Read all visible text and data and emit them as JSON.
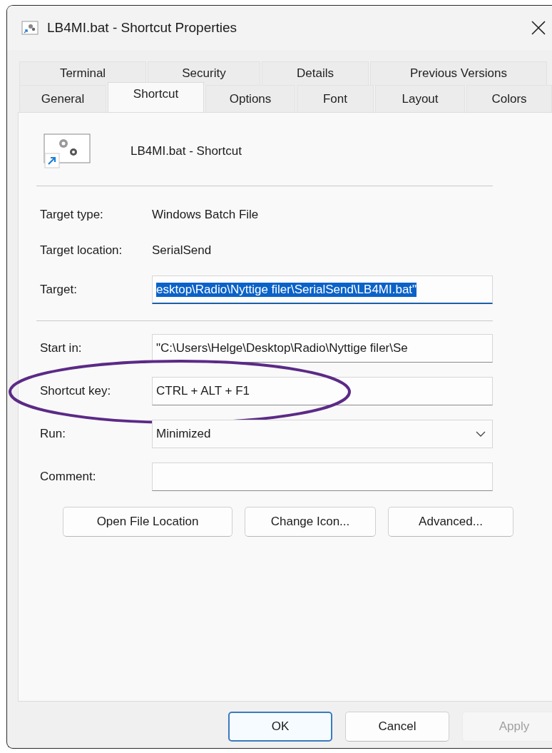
{
  "window": {
    "title": "LB4MI.bat - Shortcut Properties"
  },
  "tabs": {
    "back_row": [
      {
        "label": "Terminal",
        "selected": false
      },
      {
        "label": "Security",
        "selected": false
      },
      {
        "label": "Details",
        "selected": false
      },
      {
        "label": "Previous Versions",
        "selected": false
      }
    ],
    "front_row": [
      {
        "label": "General",
        "selected": false
      },
      {
        "label": "Shortcut",
        "selected": true
      },
      {
        "label": "Options",
        "selected": false
      },
      {
        "label": "Font",
        "selected": false
      },
      {
        "label": "Layout",
        "selected": false
      },
      {
        "label": "Colors",
        "selected": false
      }
    ]
  },
  "header": {
    "name": "LB4MI.bat - Shortcut"
  },
  "info": [
    {
      "label": "Target type:",
      "value": "Windows Batch File"
    },
    {
      "label": "Target location:",
      "value": "SerialSend"
    }
  ],
  "target_fields": [
    {
      "kind": "text",
      "label": "Target:",
      "value": "esktop\\Radio\\Nyttige filer\\SerialSend\\LB4MI.bat\"",
      "selected": true,
      "circled": false
    }
  ],
  "fields": [
    {
      "kind": "text",
      "label": "Start in:",
      "value": "\"C:\\Users\\Helge\\Desktop\\Radio\\Nyttige filer\\Se",
      "selected": false,
      "circled": false
    },
    {
      "kind": "text",
      "label": "Shortcut key:",
      "value": "CTRL + ALT + F1",
      "selected": false,
      "circled": true
    },
    {
      "kind": "dropdown",
      "label": "Run:",
      "value": "Minimized",
      "selected": false,
      "circled": false
    },
    {
      "kind": "text",
      "label": "Comment:",
      "selected": false,
      "circled": false
    }
  ],
  "action_buttons": [
    "Open File Location",
    "Change Icon...",
    "Advanced..."
  ],
  "dialog_buttons": [
    {
      "label": "OK",
      "default": true,
      "disabled": false
    },
    {
      "label": "Cancel",
      "default": false,
      "disabled": false
    },
    {
      "label": "Apply",
      "default": false,
      "disabled": true
    }
  ]
}
